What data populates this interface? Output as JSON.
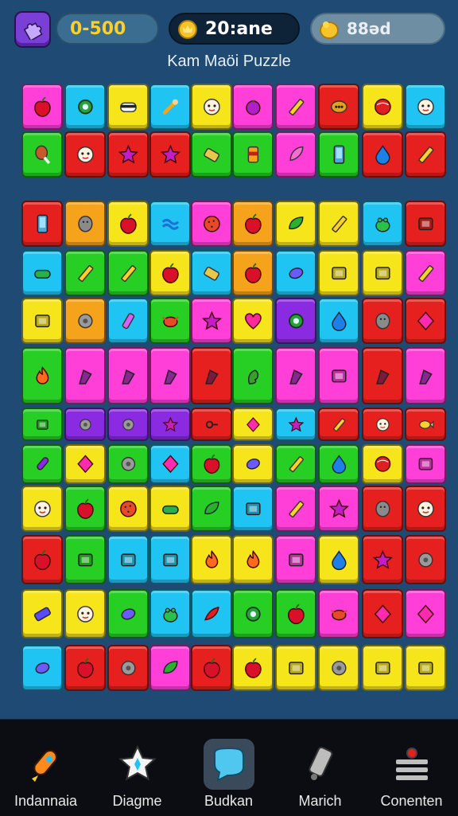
{
  "header": {
    "menu_icon": "puzzle-piece-icon",
    "score_text": "0-500",
    "coins_text": "20:ane",
    "gems_text": "88əd",
    "colors": {
      "score": "#ffd02a",
      "menu": "#7a3fd6"
    }
  },
  "game": {
    "title": "Kam Maöi Puzzle",
    "palette": {
      "M": "#ff3fd8",
      "C": "#1fc4f2",
      "Y": "#f6e51b",
      "O": "#f5a31b",
      "R": "#e6201e",
      "G": "#27cf25",
      "P": "#8a2be2",
      "L": "#9bd42a",
      "D": "#6a1fbf"
    },
    "rows": [
      [
        "M",
        "C",
        "Y",
        "C",
        "Y",
        "M",
        "M",
        "R",
        "Y",
        "C"
      ],
      [
        "G",
        "R",
        "R",
        "R",
        "G",
        "G",
        "M",
        "G",
        "R",
        "R"
      ],
      [
        "R",
        "O",
        "Y",
        "C",
        "M",
        "O",
        "Y",
        "Y",
        "C",
        "R"
      ],
      [
        "C",
        "G",
        "G",
        "Y",
        "C",
        "O",
        "C",
        "Y",
        "Y",
        "M"
      ],
      [
        "Y",
        "O",
        "C",
        "G",
        "M",
        "Y",
        "P",
        "C",
        "R",
        "R"
      ],
      [
        "G",
        "M",
        "M",
        "M",
        "R",
        "G",
        "M",
        "M",
        "R",
        "M"
      ],
      [
        "G",
        "P",
        "P",
        "P",
        "R",
        "Y",
        "C",
        "R",
        "R",
        "R"
      ],
      [
        "G",
        "Y",
        "G",
        "C",
        "G",
        "Y",
        "G",
        "G",
        "Y",
        "M"
      ],
      [
        "Y",
        "G",
        "Y",
        "Y",
        "G",
        "C",
        "M",
        "M",
        "R",
        "R"
      ],
      [
        "R",
        "G",
        "C",
        "C",
        "Y",
        "Y",
        "M",
        "Y",
        "R",
        "R"
      ],
      [
        "Y",
        "Y",
        "G",
        "C",
        "C",
        "G",
        "G",
        "M",
        "R",
        "M"
      ],
      [
        "C",
        "R",
        "R",
        "M",
        "R",
        "Y",
        "Y",
        "Y",
        "Y",
        "Y"
      ]
    ],
    "icons": [
      [
        "apple",
        "gear",
        "mask",
        "bone",
        "face",
        "berry",
        "pencil",
        "dots",
        "ball",
        "face"
      ],
      [
        "drumstick",
        "face",
        "star",
        "star",
        "battery",
        "can",
        "feather",
        "phone",
        "drop",
        "pencil"
      ],
      [
        "phone",
        "stone",
        "apple",
        "wave",
        "cookie",
        "apple",
        "leaf",
        "pencil",
        "frog",
        "box"
      ],
      [
        "pill",
        "pencil",
        "pencil",
        "apple",
        "battery",
        "apple",
        "candy",
        "box",
        "box",
        "pencil"
      ],
      [
        "box",
        "disc",
        "bottle",
        "crab",
        "star",
        "heart",
        "gear",
        "drop",
        "stone",
        "gem"
      ],
      [
        "flame",
        "shard",
        "shard",
        "shard",
        "shard",
        "foot",
        "shard",
        "box",
        "shard",
        "shard"
      ],
      [
        "box",
        "disc",
        "disc",
        "star",
        "key",
        "gem",
        "star",
        "pencil",
        "face",
        "fish"
      ],
      [
        "rocket",
        "gem",
        "disc",
        "gem",
        "apple",
        "candy",
        "pencil",
        "drop",
        "ball",
        "box"
      ],
      [
        "face",
        "apple",
        "cookie",
        "pill",
        "leaf",
        "box",
        "pencil",
        "star",
        "stone",
        "face"
      ],
      [
        "apple",
        "box",
        "box",
        "box",
        "flame",
        "flame",
        "box",
        "drop",
        "star",
        "disc"
      ],
      [
        "rect",
        "face",
        "candy",
        "frog",
        "pepper",
        "gear",
        "apple",
        "crab",
        "gem",
        "gem"
      ],
      [
        "candy",
        "apple",
        "disc",
        "leaf",
        "apple",
        "apple",
        "box",
        "disc",
        "box",
        "box"
      ]
    ]
  },
  "nav": {
    "items": [
      {
        "label": "Indannaia",
        "icon": "rocket-icon"
      },
      {
        "label": "Diagme",
        "icon": "star-icon"
      },
      {
        "label": "Budkan",
        "icon": "chat-bubble-icon"
      },
      {
        "label": "Marich",
        "icon": "phone-icon"
      },
      {
        "label": "Conenten",
        "icon": "settings-list-icon"
      }
    ]
  }
}
